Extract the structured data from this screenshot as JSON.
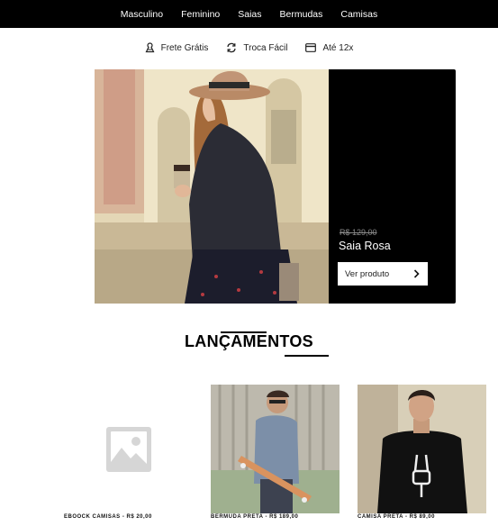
{
  "nav": {
    "items": [
      {
        "label": "Masculino"
      },
      {
        "label": "Feminino"
      },
      {
        "label": "Saias"
      },
      {
        "label": "Bermudas"
      },
      {
        "label": "Camisas"
      }
    ]
  },
  "perks": [
    {
      "label": "Frete Grátis",
      "icon": "package-icon"
    },
    {
      "label": "Troca Fácil",
      "icon": "exchange-icon"
    },
    {
      "label": "Até 12x",
      "icon": "credit-card-icon"
    }
  ],
  "hero": {
    "price": "R$ 129,00",
    "product": "Saia Rosa",
    "button": "Ver produto",
    "panel_color": "#000000"
  },
  "section": {
    "title": "LANÇAMENTOS"
  },
  "products": [
    {
      "caption": "EBOOCK CAMISAS - R$ 20,00",
      "image": "placeholder-image-icon"
    },
    {
      "caption": "BERMUDA PRETA - R$ 189,00",
      "image": "man-skateboard-photo"
    },
    {
      "caption": "CAMISA PRETA - R$ 89,00",
      "image": "man-black-shirt-photo"
    }
  ]
}
